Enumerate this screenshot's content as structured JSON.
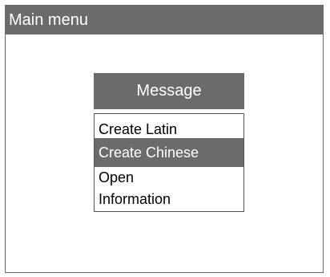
{
  "window": {
    "title": "Main menu"
  },
  "dialog": {
    "title": "Message"
  },
  "menu": {
    "items": [
      {
        "label": "Create Latin",
        "selected": false
      },
      {
        "label": "Create Chinese",
        "selected": true
      },
      {
        "label": "Open",
        "selected": false
      },
      {
        "label": "Information",
        "selected": false
      }
    ]
  },
  "colors": {
    "bar": "#6b6b6b",
    "bar_text": "#ffffff",
    "background": "#ffffff",
    "text": "#000000"
  }
}
